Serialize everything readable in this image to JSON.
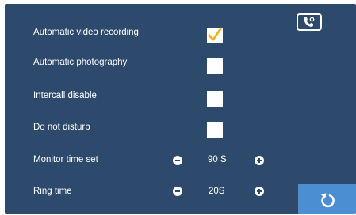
{
  "settings": {
    "auto_video": {
      "label": "Automatic video recording",
      "checked": true
    },
    "auto_photo": {
      "label": "Automatic photography",
      "checked": false
    },
    "intercall_disable": {
      "label": "Intercall disable",
      "checked": false
    },
    "do_not_disturb": {
      "label": "Do not disturb",
      "checked": false
    },
    "monitor_time": {
      "label": "Monitor time set",
      "value": "90 S"
    },
    "ring_time": {
      "label": "Ring time",
      "value": "20S"
    }
  },
  "icons": {
    "check": "checkmark-icon",
    "minus": "minus-circle-icon",
    "plus": "plus-circle-icon",
    "phone": "phone-settings-icon",
    "back": "back-arrow-icon"
  },
  "colors": {
    "background": "#2d4a6d",
    "checkmark": "#f2b21f",
    "back_button": "#4b8fd2",
    "text": "#ffffff"
  }
}
